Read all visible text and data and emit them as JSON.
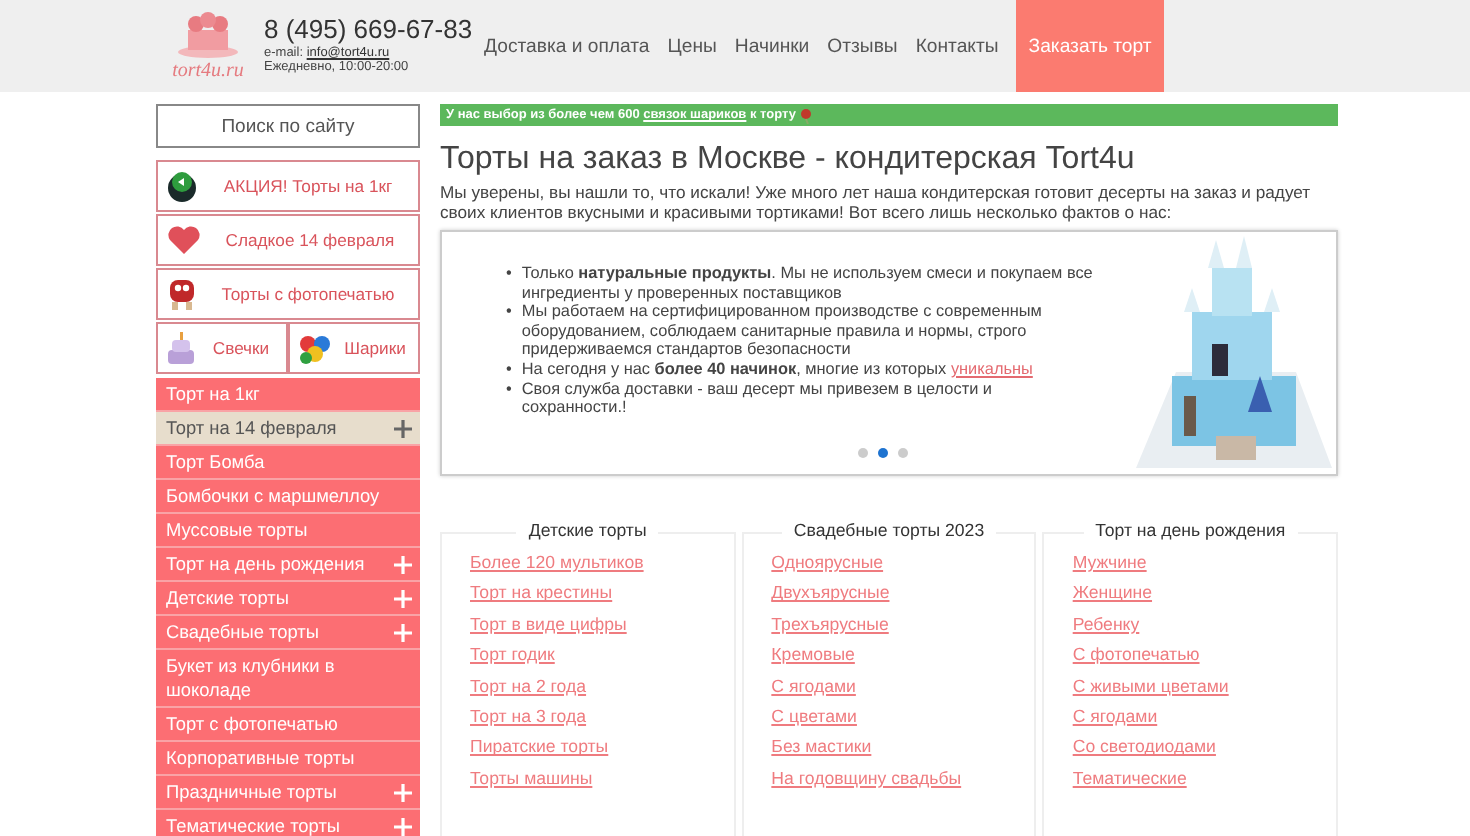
{
  "header": {
    "logo_text": "tort4u.ru",
    "phone": "8 (495) 669-67-83",
    "email_label": "e-mail:",
    "email": "info@tort4u.ru",
    "hours": "Ежедневно, 10:00-20:00",
    "nav": [
      {
        "label": "Доставка и оплата",
        "kind": "link"
      },
      {
        "label": "Цены",
        "kind": "link"
      },
      {
        "label": "Начинки",
        "kind": "link"
      },
      {
        "label": "Отзывы",
        "kind": "link"
      },
      {
        "label": "Контакты",
        "kind": "link"
      },
      {
        "label": "Заказать торт",
        "kind": "cta"
      }
    ]
  },
  "sidebar": {
    "search": "Поиск по сайту",
    "promos": [
      {
        "label": "АКЦИЯ! Торты на 1кг"
      },
      {
        "label": "Сладкое 14 февраля"
      },
      {
        "label": "Торты с фотопечатью"
      }
    ],
    "split": [
      {
        "label": "Свечки"
      },
      {
        "label": "Шарики"
      }
    ],
    "menu": [
      {
        "label": "Торт на 1кг",
        "selected": false,
        "has_submenu": false
      },
      {
        "label": "Торт на 14 февраля",
        "selected": true,
        "has_submenu": true
      },
      {
        "label": "Торт Бомба",
        "selected": false,
        "has_submenu": false
      },
      {
        "label": "Бомбочки с маршмеллоу",
        "selected": false,
        "has_submenu": false
      },
      {
        "label": "Муссовые торты",
        "selected": false,
        "has_submenu": false
      },
      {
        "label": "Торт на день рождения",
        "selected": false,
        "has_submenu": true
      },
      {
        "label": "Детские торты",
        "selected": false,
        "has_submenu": true
      },
      {
        "label": "Свадебные торты",
        "selected": false,
        "has_submenu": true
      },
      {
        "label": "Букет из клубники в шоколаде",
        "selected": false,
        "has_submenu": false
      },
      {
        "label": "Торт с фотопечатью",
        "selected": false,
        "has_submenu": false
      },
      {
        "label": "Корпоративные торты",
        "selected": false,
        "has_submenu": false
      },
      {
        "label": "Праздничные торты",
        "selected": false,
        "has_submenu": true
      },
      {
        "label": "Тематические торты",
        "selected": false,
        "has_submenu": true
      }
    ]
  },
  "main": {
    "notice": {
      "before": "У нас выбор из более чем 600",
      "link": "связок шариков",
      "after": "к торту"
    },
    "title": "Торты на заказ в Москве - кондитерская Tort4u",
    "intro": "Мы уверены, вы нашли то, что искали! Уже много лет наша кондитерская готовит десерты на заказ и радует своих клиентов вкусными и красивыми тортиками! Вот всего лишь несколько фактов о нас:",
    "slider": {
      "facts": [
        "Только **натуральные продукты**. Мы не используем смеси и покупаем все ингредиенты у проверенных поставщиков",
        "Мы работаем на сертифицированном производстве с современным оборудованием, соблюдаем санитарные правила и нормы, строго придерживаемся стандартов безопасности",
        "На сегодня у нас **более 40 начинок**, многие из которых",
        "Своя служба доставки - ваш десерт мы привезем в целости и сохранности.!"
      ],
      "fact_link": "уникальны",
      "bullet": "•",
      "dots": [
        {
          "selected": false
        },
        {
          "selected": true
        },
        {
          "selected": false
        }
      ]
    },
    "categories": [
      {
        "title": "Детские торты",
        "links": [
          "Более 120 мультиков",
          "Торт на крестины",
          "Торт в виде цифры",
          "Торт годик",
          "Торт на 2 года",
          "Торт на 3 года",
          "Пиратские торты",
          "Торты машины"
        ]
      },
      {
        "title": "Свадебные торты 2023",
        "links": [
          "Одноярусные",
          "Двухъярусные",
          "Трехъярусные",
          "Кремовые",
          "С ягодами",
          "С цветами",
          "Без мастики",
          "На годовщину свадьбы"
        ]
      },
      {
        "title": "Торт на день рождения",
        "links": [
          "Мужчине",
          "Женщине",
          "Ребенку",
          "С фотопечатью",
          "С живыми цветами",
          "С ягодами",
          "Со светодиодами",
          "Тематические"
        ]
      }
    ]
  }
}
